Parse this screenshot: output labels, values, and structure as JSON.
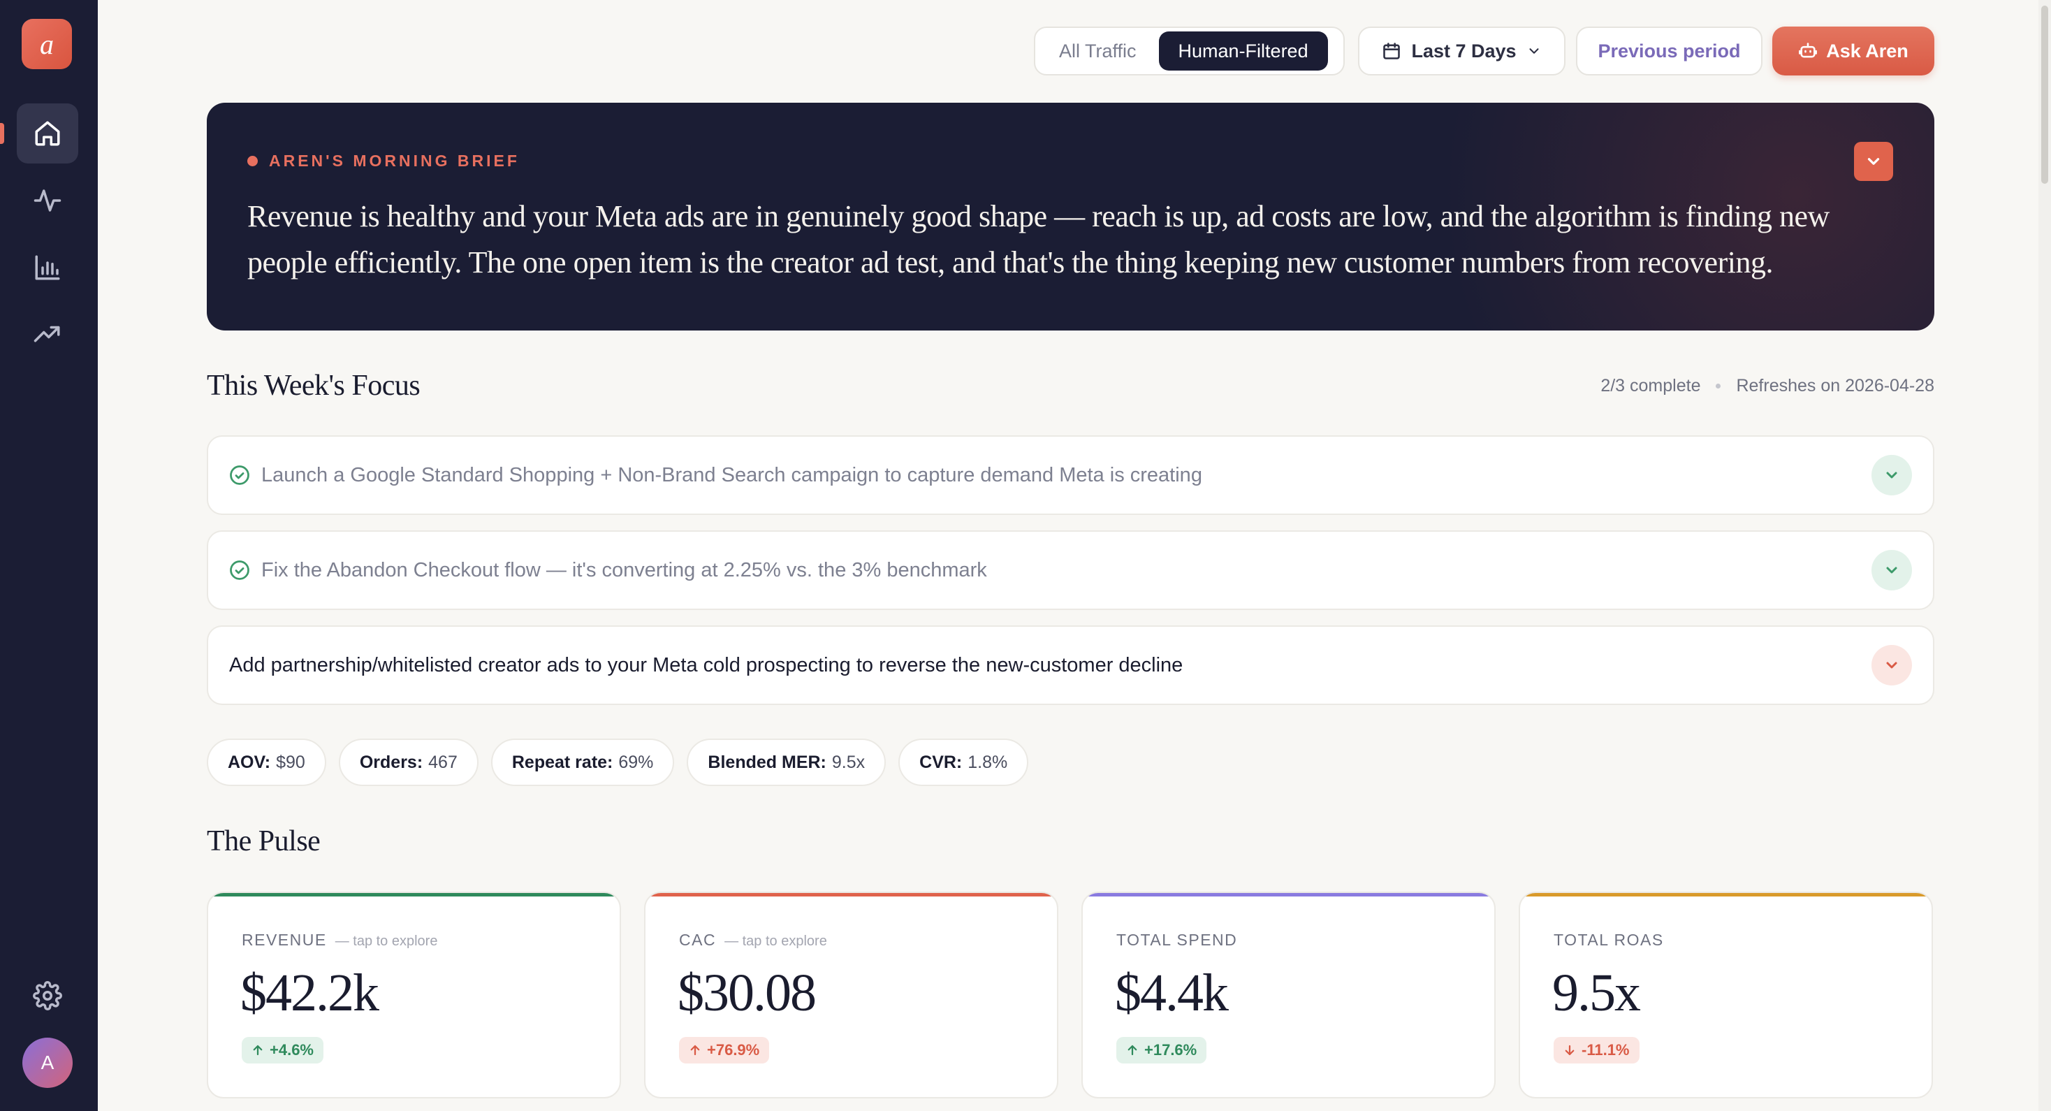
{
  "logo": {
    "letter": "a"
  },
  "sidebar": {
    "items": [
      {
        "name": "home",
        "active": true
      },
      {
        "name": "activity"
      },
      {
        "name": "analytics"
      },
      {
        "name": "trends"
      }
    ],
    "avatar_initial": "A"
  },
  "toolbar": {
    "traffic_options": [
      "All Traffic",
      "Human-Filtered"
    ],
    "traffic_selected": "Human-Filtered",
    "date_range": "Last 7 Days",
    "compare_label": "Previous period",
    "ask_label": "Ask Aren"
  },
  "brief": {
    "tag": "AREN'S MORNING BRIEF",
    "text": "Revenue is healthy and your Meta ads are in genuinely good shape — reach is up, ad costs are low, and the algorithm is finding new people efficiently. The one open item is the creator ad test, and that's the thing keeping new customer numbers from recovering."
  },
  "focus": {
    "title": "This Week's Focus",
    "progress": "2/3 complete",
    "refresh": "Refreshes on 2026-04-28",
    "items": [
      {
        "label": "Launch a Google Standard Shopping + Non-Brand Search campaign to capture demand Meta is creating",
        "done": true
      },
      {
        "label": "Fix the Abandon Checkout flow — it's converting at 2.25% vs. the 3% benchmark",
        "done": true
      },
      {
        "label": "Add partnership/whitelisted creator ads to your Meta cold prospecting to reverse the new-customer decline",
        "done": false
      }
    ]
  },
  "metrics_pills": [
    {
      "key": "AOV:",
      "value": "$90"
    },
    {
      "key": "Orders:",
      "value": "467"
    },
    {
      "key": "Repeat rate:",
      "value": "69%"
    },
    {
      "key": "Blended MER:",
      "value": "9.5x"
    },
    {
      "key": "CVR:",
      "value": "1.8%"
    }
  ],
  "pulse": {
    "title": "The Pulse",
    "cards": [
      {
        "name": "REVENUE",
        "hint": "— tap to explore",
        "value": "$42.2k",
        "delta": "+4.6%",
        "color": "#2f8a5c"
      },
      {
        "name": "CAC",
        "hint": "— tap to explore",
        "value": "$30.08",
        "delta": "+76.9%",
        "color": "#e0634c"
      },
      {
        "name": "TOTAL SPEND",
        "hint": "",
        "value": "$4.4k",
        "delta": "+17.6%",
        "color": "#8a7be0"
      },
      {
        "name": "TOTAL ROAS",
        "hint": "",
        "value": "9.5x",
        "delta": "-11.1%",
        "color": "#d99a2b"
      }
    ]
  }
}
